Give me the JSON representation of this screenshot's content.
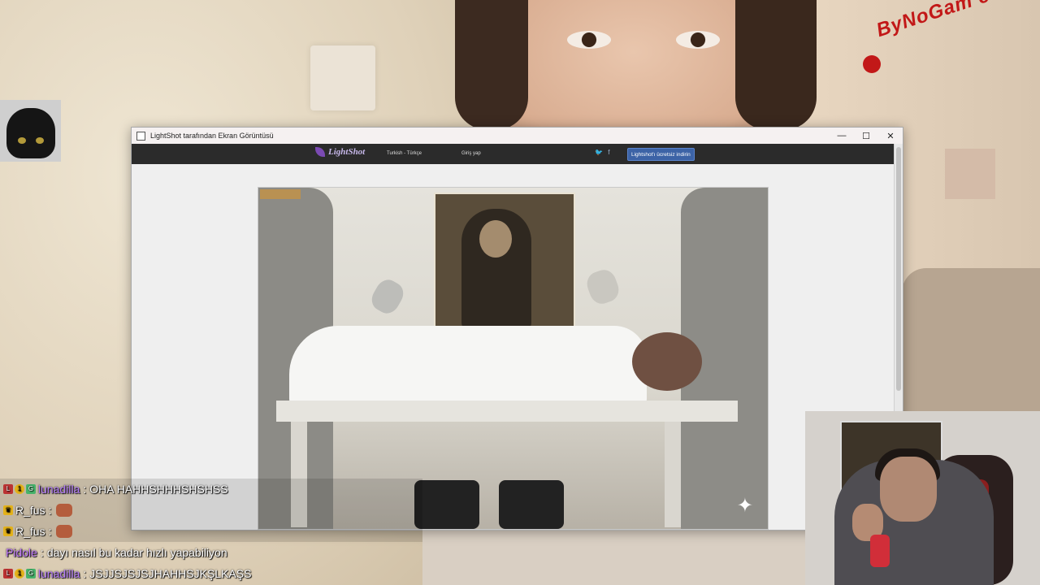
{
  "overlay_logo": {
    "text": "ByNoGam e",
    "color": "#c21818"
  },
  "window": {
    "title": "LightShot tarafından Ekran Görüntüsü",
    "controls": {
      "minimize": "—",
      "maximize": "☐",
      "close": "✕"
    }
  },
  "lightshot_bar": {
    "brand": "LightShot",
    "language": "Turkish - Türkçe",
    "login": "Giriş yap",
    "social": {
      "twitter": "🐦",
      "facebook": "f"
    },
    "download_button": "Lightshot'ı ücretsiz indirin"
  },
  "screenshot": {
    "sparkle": "✦"
  },
  "chat": [
    {
      "user": "lunadilla",
      "user_color": "#b980ff",
      "badges": [
        "L",
        "1",
        "G"
      ],
      "message": "OHA HAHHSHHHSHSHSS",
      "emote": false
    },
    {
      "user": "R_fus",
      "user_color": "#ffffff",
      "badges": [
        "♛"
      ],
      "message": "",
      "emote": true
    },
    {
      "user": "R_fus",
      "user_color": "#ffffff",
      "badges": [
        "♛"
      ],
      "message": "",
      "emote": true
    },
    {
      "user": "Pidole",
      "user_color": "#c57dff",
      "badges": [],
      "message": "dayı nasıl bu kadar hızlı yapabiliyon",
      "emote": false
    },
    {
      "user": "lunadilla",
      "user_color": "#b980ff",
      "badges": [
        "L",
        "1",
        "G"
      ],
      "message": "JSJJSJSJSJHAHHSJKŞLKAŞS",
      "emote": false
    }
  ]
}
